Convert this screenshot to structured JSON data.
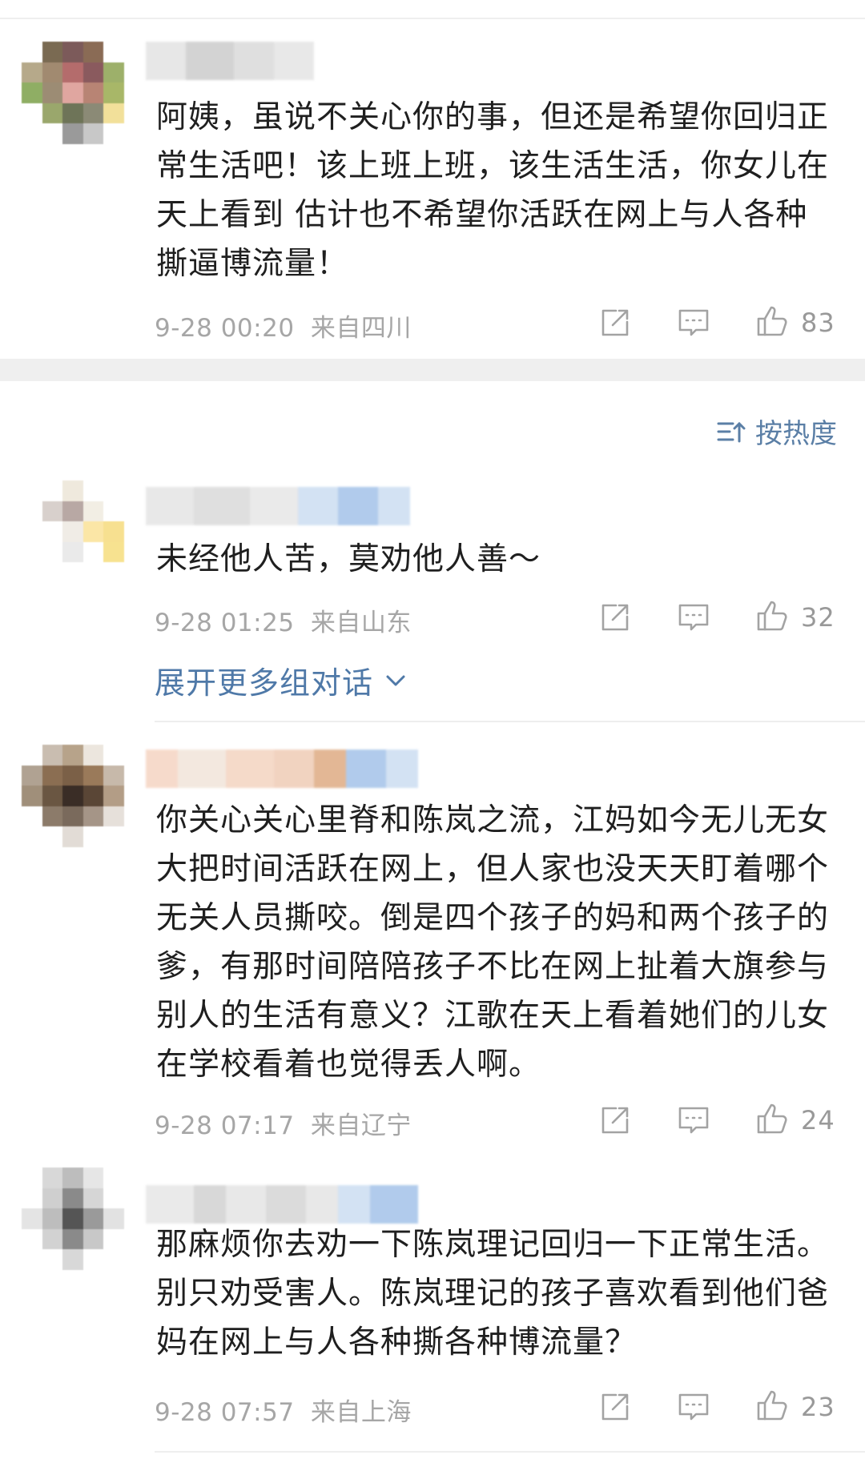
{
  "sort_label": "按热度",
  "expand_label": "展开更多组对话",
  "comments": [
    {
      "text": "阿姨，虽说不关心你的事，但还是希望你回归正常生活吧！该上班上班，该生活生活，你女儿在天上看到 估计也不希望你活跃在网上与人各种撕逼博流量！",
      "time": "9-28 00:20",
      "location": "来自四川",
      "likes": "83"
    },
    {
      "text": "未经他人苦，莫劝他人善～",
      "time": "9-28 01:25",
      "location": "来自山东",
      "likes": "32"
    },
    {
      "text": "你关心关心里脊和陈岚之流，江妈如今无儿无女大把时间活跃在网上，但人家也没天天盯着哪个无关人员撕咬。倒是四个孩子的妈和两个孩子的爹，有那时间陪陪孩子不比在网上扯着大旗参与别人的生活有意义？江歌在天上看着她们的儿女在学校看着也觉得丢人啊。",
      "time": "9-28 07:17",
      "location": "来自辽宁",
      "likes": "24"
    },
    {
      "text": "那麻烦你去劝一下陈岚理记回归一下正常生活。别只劝受害人。陈岚理记的孩子喜欢看到他们爸妈在网上与人各种撕各种博流量？",
      "time": "9-28 07:57",
      "location": "来自上海",
      "likes": "23"
    }
  ],
  "icons": {
    "share": "share-icon",
    "comment": "comment-icon",
    "like": "thumbs-up-icon",
    "sort": "sort-icon",
    "expand": "chevron-down-icon"
  },
  "colors": {
    "link": "#4f79a8",
    "meta": "#a6a6a6",
    "separator": "#efefef"
  }
}
